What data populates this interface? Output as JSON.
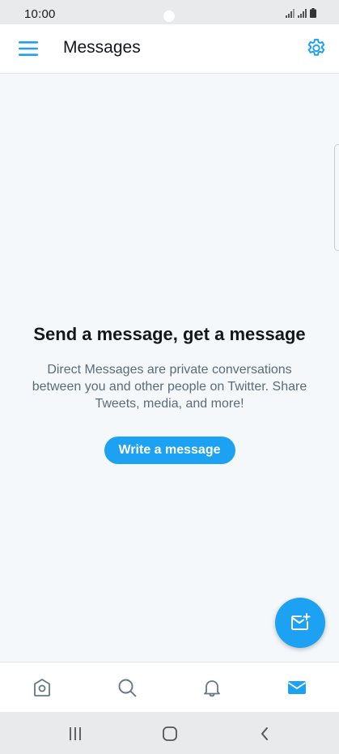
{
  "status_bar": {
    "time": "10:00"
  },
  "header": {
    "title": "Messages",
    "menu_icon": "hamburger-menu-icon",
    "settings_icon": "gear-icon"
  },
  "empty_state": {
    "title": "Send a message, get a message",
    "description": "Direct Messages are private conversations between you and other people on Twitter. Share Tweets, media, and more!",
    "button_label": "Write a message"
  },
  "fab": {
    "icon": "new-message-icon"
  },
  "tabs": [
    {
      "name": "home",
      "icon": "home-icon",
      "active": false
    },
    {
      "name": "search",
      "icon": "search-icon",
      "active": false
    },
    {
      "name": "notifications",
      "icon": "bell-icon",
      "active": false
    },
    {
      "name": "messages",
      "icon": "envelope-icon",
      "active": true
    }
  ],
  "colors": {
    "accent": "#1da1f2",
    "text_primary": "#14171a",
    "text_secondary": "#5b6b78",
    "background": "#f5f8fa",
    "icon_inactive": "#657786"
  },
  "nav_bar": {
    "buttons": [
      "recent-apps-icon",
      "home-circle-icon",
      "back-chevron-icon"
    ]
  }
}
